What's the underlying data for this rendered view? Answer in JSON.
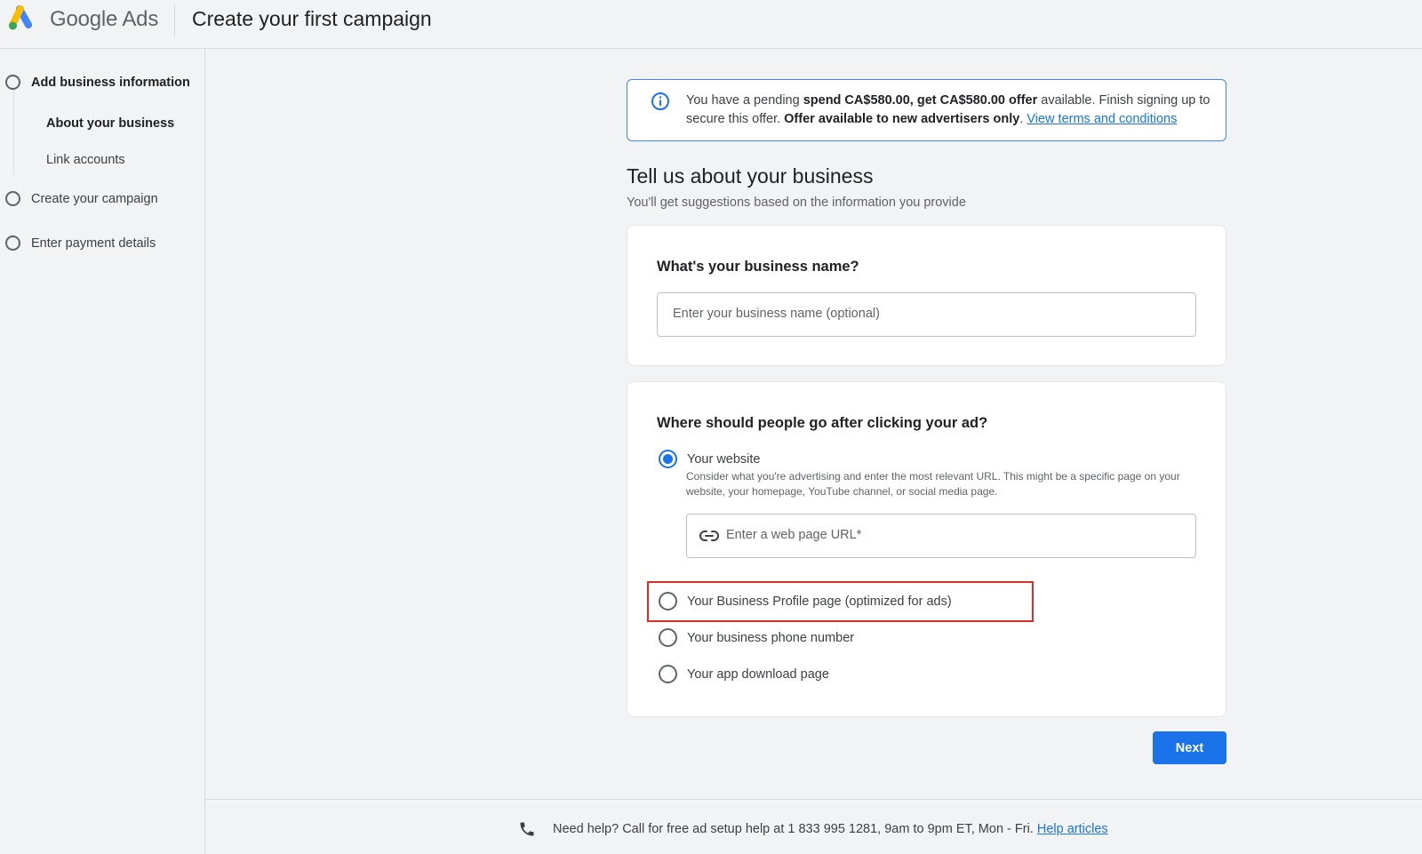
{
  "header": {
    "brand_google": "Google",
    "brand_ads": "Ads",
    "title": "Create your first campaign"
  },
  "sidebar": {
    "steps": [
      {
        "label": "Add business information",
        "substeps": [
          "About your business",
          "Link accounts"
        ]
      },
      {
        "label": "Create your campaign"
      },
      {
        "label": "Enter payment details"
      }
    ]
  },
  "banner": {
    "text_1": "You have a pending ",
    "offer_bold": "spend CA$580.00, get CA$580.00 offer",
    "text_2": " available. Finish signing up to secure this offer. ",
    "new_bold": "Offer available to new advertisers only",
    "text_3": ". ",
    "link": "View terms and conditions"
  },
  "section": {
    "title": "Tell us about your business",
    "subtitle": "You'll get suggestions based on the information you provide"
  },
  "business_name": {
    "question": "What's your business name?",
    "placeholder": "Enter your business name (optional)"
  },
  "destination": {
    "question": "Where should people go after clicking your ad?",
    "options": [
      {
        "label": "Your website",
        "selected": true
      },
      {
        "label": "Your Business Profile page (optimized for ads)",
        "selected": false
      },
      {
        "label": "Your business phone number",
        "selected": false
      },
      {
        "label": "Your app download page",
        "selected": false
      }
    ],
    "website_description": "Consider what you're advertising and enter the most relevant URL. This might be a specific page on your website, your homepage, YouTube channel, or social media page.",
    "url_placeholder": "Enter a web page URL*"
  },
  "next_label": "Next",
  "footer": {
    "text": "Need help? Call for free ad setup help at 1 833 995 1281, 9am to 9pm ET, Mon - Fri. ",
    "link": "Help articles"
  },
  "colors": {
    "accent": "#1a73e8",
    "highlight": "#d93025",
    "background": "#f1f3f4"
  },
  "icons": [
    "google-ads-logo",
    "info-icon",
    "link-icon",
    "phone-icon"
  ]
}
